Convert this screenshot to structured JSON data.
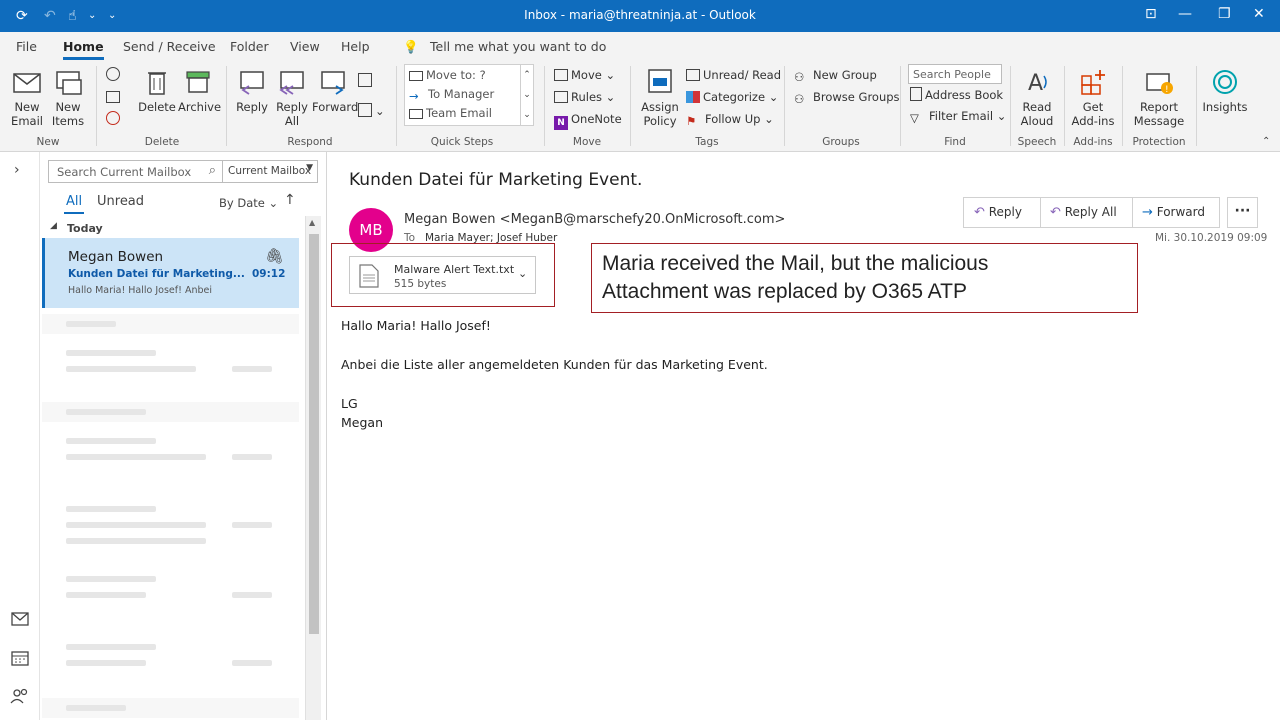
{
  "window": {
    "title": "Inbox - maria@threatninja.at - Outlook"
  },
  "tabs": [
    "File",
    "Home",
    "Send / Receive",
    "Folder",
    "View",
    "Help"
  ],
  "tell_me": "Tell me what you want to do",
  "ribbon": {
    "new_email": "New Email",
    "new_items": "New Items",
    "delete": "Delete",
    "archive": "Archive",
    "reply": "Reply",
    "reply_all": "Reply All",
    "forward": "Forward",
    "quick_steps": [
      "Move to: ?",
      "To Manager",
      "Team Email"
    ],
    "move": "Move",
    "rules": "Rules",
    "onenote": "OneNote",
    "assign_policy": "Assign Policy",
    "unread_read": "Unread/ Read",
    "categorize": "Categorize",
    "follow_up": "Follow Up",
    "new_group": "New Group",
    "browse_groups": "Browse Groups",
    "search_people_placeholder": "Search People",
    "address_book": "Address Book",
    "filter_email": "Filter Email",
    "read_aloud": "Read Aloud",
    "get_addins": "Get Add-ins",
    "report_message": "Report Message",
    "insights": "Insights",
    "groups": [
      "New",
      "Delete",
      "Respond",
      "Quick Steps",
      "Move",
      "Tags",
      "Groups",
      "Find",
      "Speech",
      "Add-ins",
      "Protection"
    ]
  },
  "list": {
    "search_placeholder": "Search Current Mailbox",
    "mailbox_scope": "Current Mailbox",
    "filter_all": "All",
    "filter_unread": "Unread",
    "sort": "By Date",
    "group_today": "Today",
    "selected": {
      "sender": "Megan Bowen",
      "subject": "Kunden Datei für Marketing...",
      "time": "09:12",
      "preview": "Hallo Maria! Hallo Josef!  Anbei"
    }
  },
  "message": {
    "subject": "Kunden Datei für Marketing Event.",
    "avatar_initials": "MB",
    "avatar_color": "#e3008c",
    "from": "Megan Bowen <MeganB@marschefy20.OnMicrosoft.com>",
    "to_label": "To",
    "to": "Maria Mayer; Josef Huber",
    "date": "Mi. 30.10.2019 09:09",
    "attachment_name": "Malware Alert Text.txt",
    "attachment_size": "515 bytes",
    "body": [
      "Hallo Maria! Hallo Josef!",
      "Anbei die Liste aller angemeldeten Kunden für das Marketing Event.",
      "LG",
      "Megan"
    ],
    "actions": {
      "reply": "Reply",
      "reply_all": "Reply All",
      "forward": "Forward"
    }
  },
  "annotation": {
    "line1": "Maria received the Mail, but the malicious",
    "line2": "Attachment was replaced by O365 ATP",
    "color": "#a31f24"
  },
  "accent": "#0f6cbd"
}
